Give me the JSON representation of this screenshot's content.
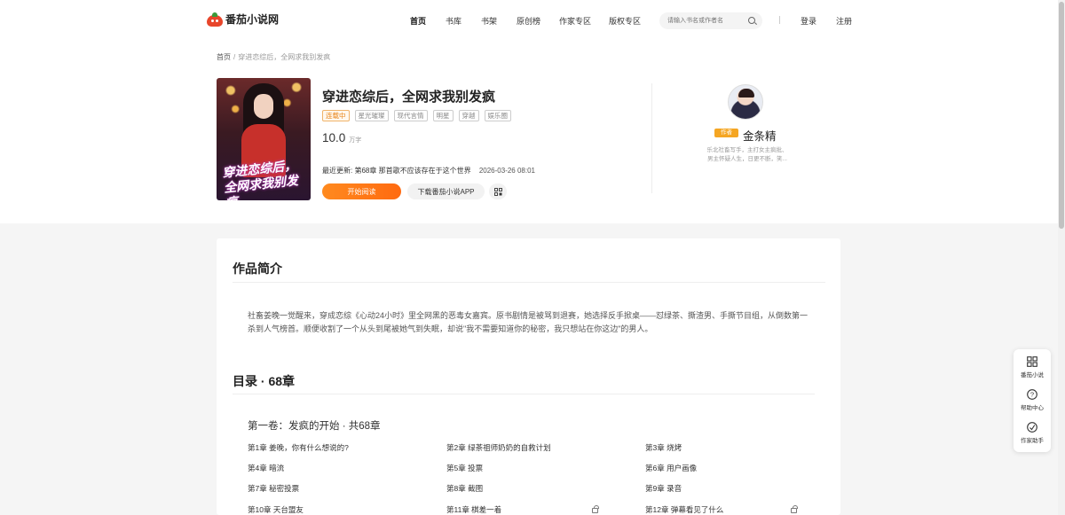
{
  "header": {
    "logo_text": "番茄小说网",
    "nav": [
      "首页",
      "书库",
      "书架",
      "原创榜",
      "作家专区",
      "版权专区"
    ],
    "search_placeholder": "请输入书名或作者名",
    "login": "登录",
    "register": "注册"
  },
  "breadcrumb": {
    "home": "首页",
    "separator": "/",
    "current": "穿进恋综后，全网求我别发疯"
  },
  "book": {
    "cover_text": "穿进恋综后，全网求我别发疯",
    "title": "穿进恋综后，全网求我别发疯",
    "status": "连载中",
    "tags": [
      "星光璀璨",
      "现代言情",
      "明星",
      "穿越",
      "娱乐圈"
    ],
    "word_count": "10.0",
    "word_unit": "万字",
    "latest_label": "最近更新:",
    "latest_chapter": "第68章 那首歌不应该存在于这个世界",
    "latest_time": "2026-03-26 08:01",
    "read_button": "开始阅读",
    "app_button": "下载番茄小说APP"
  },
  "author": {
    "badge": "作者",
    "name": "金条精",
    "desc_line1": "乐北社畜写手，主打女主疯批、",
    "desc_line2": "男主怀疑人生，日更不断，笑..."
  },
  "intro": {
    "title": "作品简介",
    "text": "社畜姜晚一觉醒来，穿成恋综《心动24小时》里全网黑的恶毒女嘉宾。原书剧情是被骂到退赛，她选择反手掀桌——怼绿茶、撕渣男、手撕节目组，从倒数第一杀到人气榜首。顺便收割了一个从头到尾被她气到失眠，却说\"我不需要知道你的秘密，我只想站在你这边\"的男人。"
  },
  "catalog": {
    "title": "目录 · 68章",
    "volume": "第一卷：发疯的开始 · 共68章",
    "chapters": [
      "第1章 姜晚，你有什么想说的?",
      "第2章 绿茶祖师奶奶的自救计划",
      "第3章 烧烤",
      "第4章 暗流",
      "第5章 投票",
      "第6章 用户画像",
      "第7章 秘密投票",
      "第8章 截图",
      "第9章 录音",
      "第10章 天台盟友",
      "第11章 棋差一着",
      "第12章 弹幕看见了什么"
    ]
  },
  "side_panel": [
    "番茄小说",
    "帮助中心",
    "作家助手"
  ]
}
